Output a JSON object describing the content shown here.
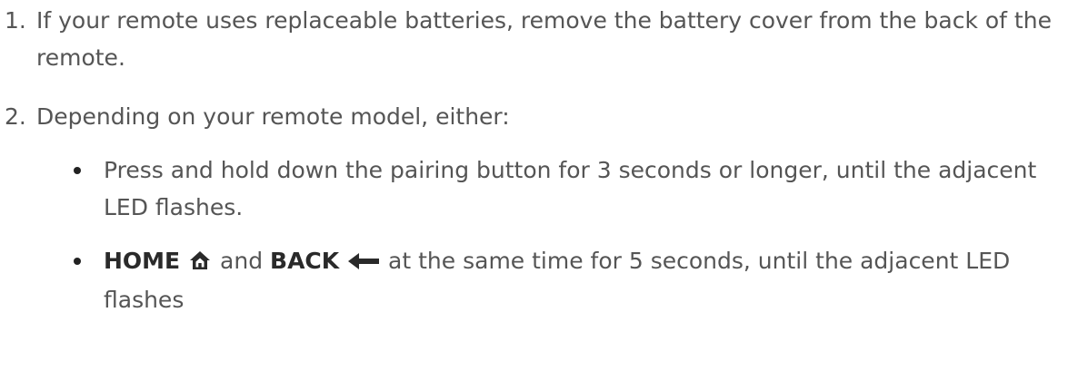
{
  "steps": [
    {
      "number": "1.",
      "text": "If your remote uses replaceable batteries, remove the battery cover from the back of the remote."
    },
    {
      "number": "2.",
      "text": "Depending on your remote model, either:",
      "options": [
        {
          "text": "Press and hold down the pairing button for 3 seconds or longer, until the adjacent LED flashes."
        },
        {
          "key_home": "HOME",
          "home_icon": "home-icon",
          "and": " and ",
          "key_back": "BACK",
          "back_icon": "back-arrow-icon",
          "rest": " at the same time for 5 seconds, until the adjacent LED flashes"
        }
      ]
    }
  ]
}
